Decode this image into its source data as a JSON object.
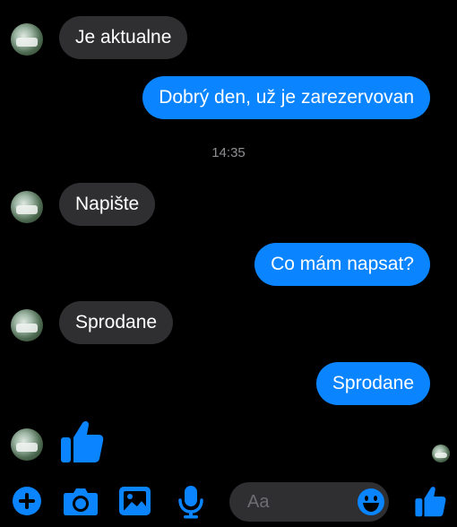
{
  "accent_color": "#0a84ff",
  "incoming_bubble_color": "#2f2f31",
  "messages": [
    {
      "direction": "incoming",
      "text": "Je aktualne"
    },
    {
      "direction": "outgoing",
      "text": "Dobrý den, už je zarezervovan"
    },
    {
      "direction": "incoming",
      "text": "Napište"
    },
    {
      "direction": "outgoing",
      "text": "Co mám napsat?"
    },
    {
      "direction": "incoming",
      "text": "Sprodane"
    },
    {
      "direction": "outgoing",
      "text": "Sprodane"
    },
    {
      "direction": "incoming",
      "type": "thumbs-up-icon"
    }
  ],
  "timestamp": "14:35",
  "composer": {
    "placeholder": "Aa"
  },
  "toolbar": {
    "icons": [
      "plus-icon",
      "camera-icon",
      "gallery-icon",
      "microphone-icon",
      "emoji-icon",
      "thumbs-up-icon"
    ]
  }
}
